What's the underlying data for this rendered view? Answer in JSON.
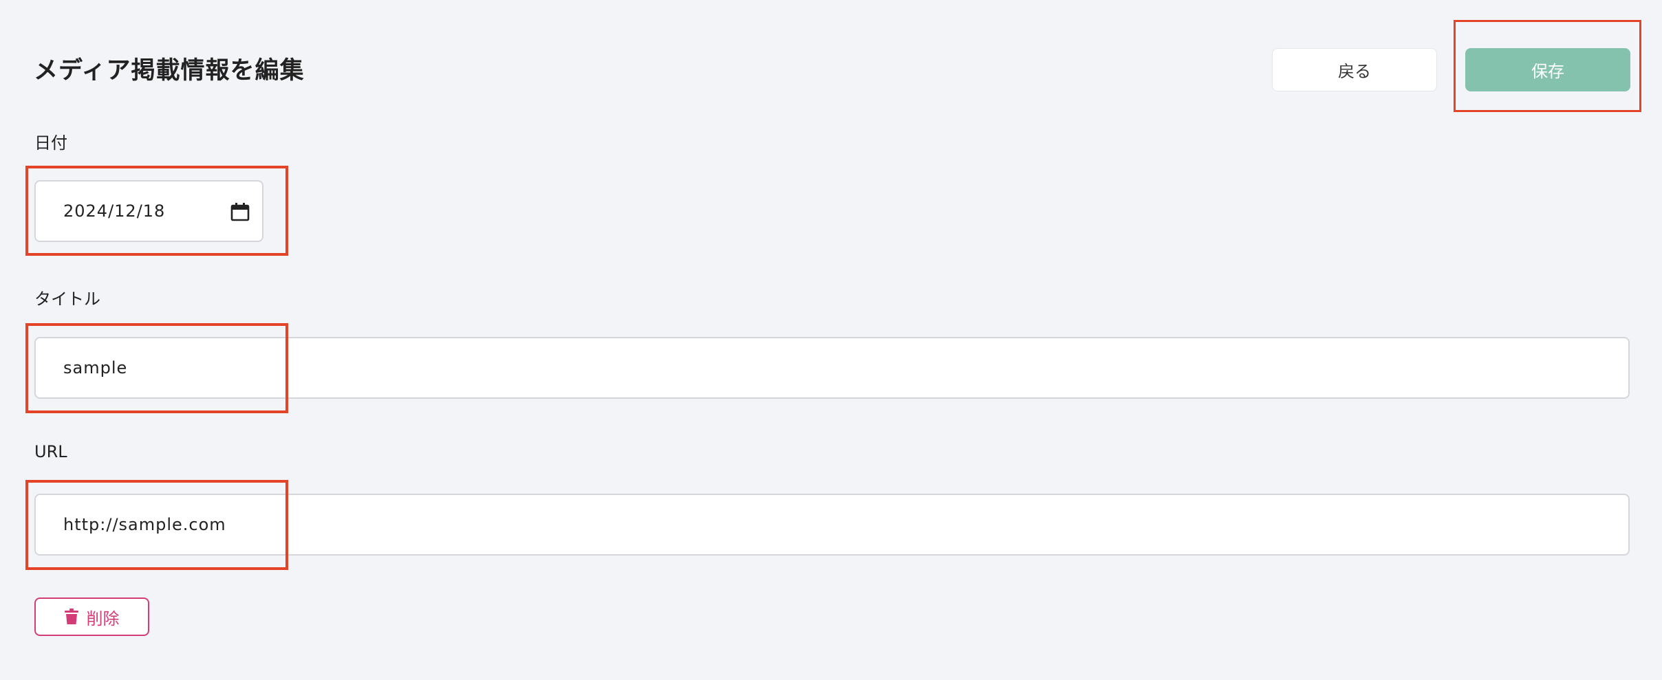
{
  "page": {
    "title": "メディア掲載情報を編集"
  },
  "header": {
    "back_label": "戻る",
    "save_label": "保存"
  },
  "form": {
    "date": {
      "label": "日付",
      "value": "2024/12/18",
      "icon": "calendar-icon"
    },
    "title": {
      "label": "タイトル",
      "value": "sample"
    },
    "url": {
      "label": "URL",
      "value": "http://sample.com"
    }
  },
  "actions": {
    "delete_label": "削除",
    "delete_icon": "trash-icon"
  },
  "colors": {
    "background": "#f3f4f8",
    "save_button": "#85c2ae",
    "delete_accent": "#d43c78",
    "highlight": "#e34428"
  }
}
